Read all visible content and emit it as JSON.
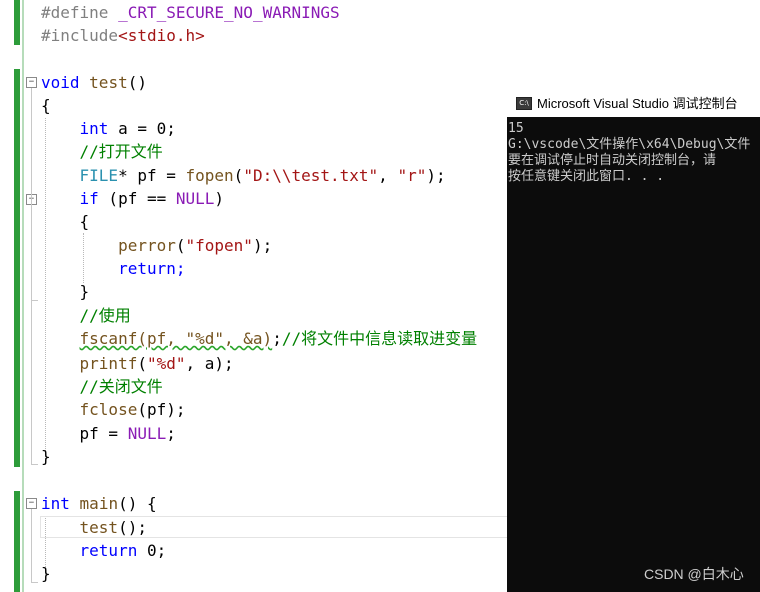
{
  "code": {
    "l1_kw": "#define",
    "l1_macro": "_CRT_SECURE_NO_WARNINGS",
    "l2_kw": "#include",
    "l2_file": "<stdio.h>",
    "l4_kw": "void",
    "l4_name": "test",
    "l4_rest": "()",
    "l5": "{",
    "l6_kw": "int",
    "l6_rest": " a = 0;",
    "l7": "//打开文件",
    "l8_type": "FILE",
    "l8_a": "* pf = ",
    "l8_fn": "fopen",
    "l8_b": "(",
    "l8_s1": "\"D:\\\\test.txt\"",
    "l8_c": ", ",
    "l8_s2": "\"r\"",
    "l8_d": ");",
    "l9_kw": "if",
    "l9_a": " (pf == ",
    "l9_mac": "NULL",
    "l9_b": ")",
    "l10": "{",
    "l11_fn": "perror",
    "l11_a": "(",
    "l11_s": "\"fopen\"",
    "l11_b": ");",
    "l12": "return;",
    "l13": "}",
    "l14": "//使用",
    "l15_sq": "fscanf(pf, \"%d\", &a)",
    "l15_a": ";",
    "l15_cm": "//将文件中信息读取进变量",
    "l16_fn": "printf",
    "l16_a": "(",
    "l16_s": "\"%d\"",
    "l16_b": ", a);",
    "l17": "//关闭文件",
    "l18_fn": "fclose",
    "l18_a": "(pf);",
    "l19_a": "pf = ",
    "l19_mac": "NULL",
    "l19_b": ";",
    "l20": "}",
    "l22_kw": "int",
    "l22_name": "main",
    "l22_rest": "() {",
    "l23_fn": "test",
    "l23_a": "();",
    "l24_kw": "return",
    "l24_a": " 0;",
    "l25": "}"
  },
  "console": {
    "title": "Microsoft Visual Studio 调试控制台",
    "icon": "console-app-icon",
    "icon_glyph": "C:\\",
    "lines": [
      "15",
      "G:\\vscode\\文件操作\\x64\\Debug\\文件",
      "要在调试停止时自动关闭控制台，请",
      "按任意键关闭此窗口. . ."
    ],
    "watermark": "CSDN @白木心"
  },
  "colors": {
    "keyword": "#0000ff",
    "comment": "#008000",
    "string": "#a31515",
    "macro": "#8a1bb5",
    "type": "#2b91af",
    "change_bar": "#2d9c3a",
    "console_bg": "#0c0c0c"
  }
}
